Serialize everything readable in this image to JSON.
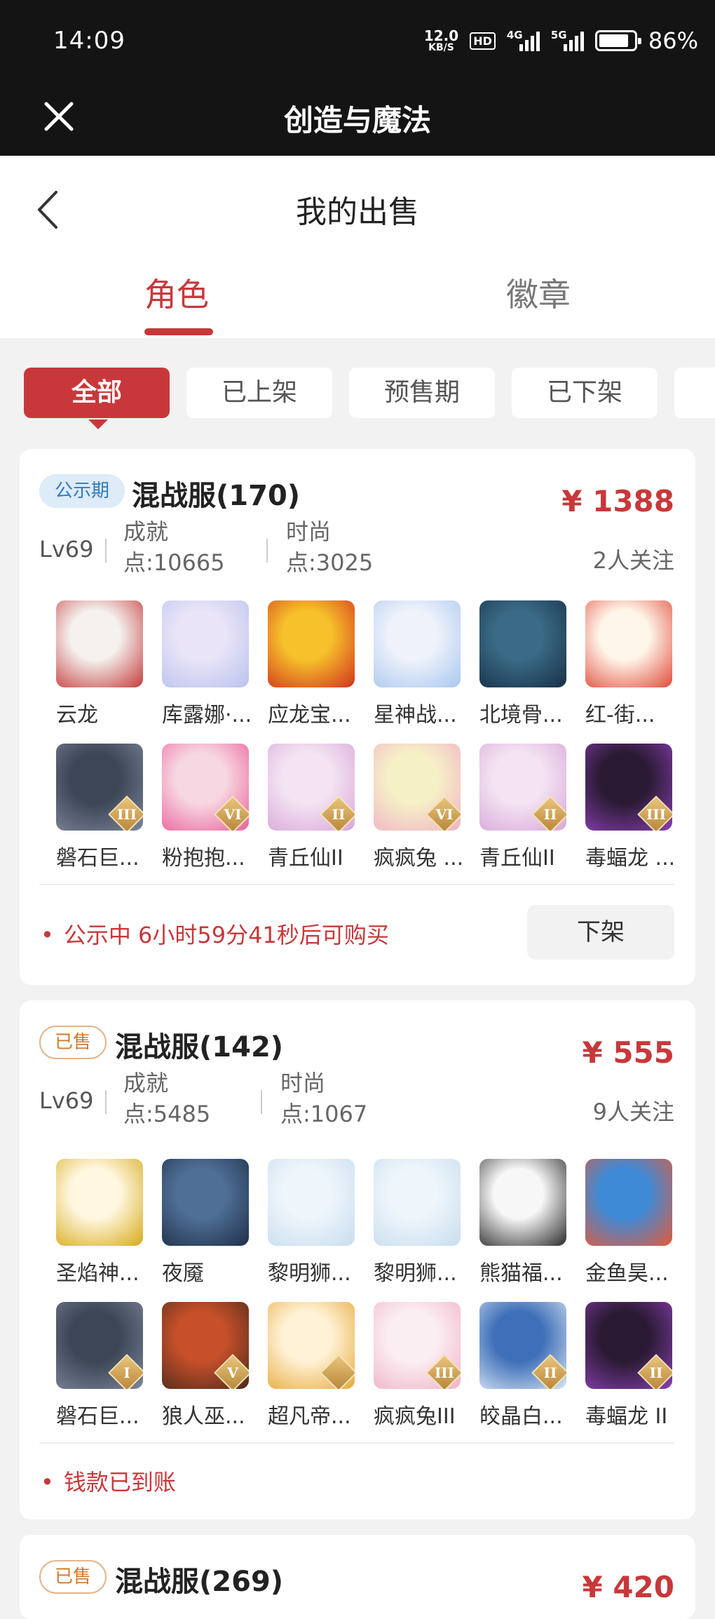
{
  "status": {
    "time": "14:09",
    "speed_value": "12.0",
    "speed_unit": "KB/S",
    "hd": "HD",
    "net1": "4G",
    "net2": "5G",
    "battery": "86%",
    "battery_level": 0.86
  },
  "titlebar": {
    "title": "创造与魔法"
  },
  "header": {
    "title": "我的出售"
  },
  "tabs": [
    {
      "label": "角色"
    },
    {
      "label": "徽章"
    }
  ],
  "filters": [
    "全部",
    "已上架",
    "预售期",
    "已下架",
    "已"
  ],
  "cards": [
    {
      "badge": "公示期",
      "server": "混战服(170)",
      "price": "¥ 1388",
      "level": "Lv69",
      "achievement_label": "成就",
      "achievement_value": "点:10665",
      "fashion_label": "时尚",
      "fashion_value": "点:3025",
      "followers": "2人关注",
      "items": [
        {
          "name": "云龙",
          "icon": "cloud-dragon-icon",
          "colors": [
            "#f4f1ee",
            "#c43b3b"
          ]
        },
        {
          "name": "库露娜·...",
          "icon": "kuluna-icon",
          "colors": [
            "#e9e4f7",
            "#b9c2ef"
          ]
        },
        {
          "name": "应龙宝...",
          "icon": "yinglong-icon",
          "colors": [
            "#f6c12a",
            "#d2321f"
          ]
        },
        {
          "name": "星神战...",
          "icon": "star-god-icon",
          "colors": [
            "#eef2fb",
            "#a9c7ef"
          ]
        },
        {
          "name": "北境骨...",
          "icon": "north-bone-icon",
          "colors": [
            "#3a6a86",
            "#173046"
          ]
        },
        {
          "name": "红-街...",
          "icon": "red-skateboard-icon",
          "colors": [
            "#fff6ea",
            "#e04a3a"
          ]
        },
        {
          "name": "磐石巨...",
          "icon": "rock-giant-icon",
          "colors": [
            "#3d4657",
            "#7d8699"
          ],
          "tier": "III"
        },
        {
          "name": "粉抱抱...",
          "icon": "pink-bear-icon",
          "colors": [
            "#f7d8e2",
            "#ea5f9a"
          ],
          "tier": "VI"
        },
        {
          "name": "青丘仙II",
          "icon": "fox-fairy-icon",
          "colors": [
            "#f4e4f3",
            "#d7a6d8"
          ],
          "tier": "II"
        },
        {
          "name": "疯疯兔 ...",
          "icon": "crazy-rabbit-icon",
          "colors": [
            "#f6f0c7",
            "#f0b2c6"
          ],
          "tier": "VI"
        },
        {
          "name": "青丘仙II",
          "icon": "fox-fairy-icon",
          "colors": [
            "#f4e4f3",
            "#d7a6d8"
          ],
          "tier": "II"
        },
        {
          "name": "毒蝠龙 ...",
          "icon": "poison-bat-dragon-icon",
          "colors": [
            "#2a1a33",
            "#8a3fb2"
          ],
          "tier": "III"
        }
      ],
      "notice": "公示中 6小时59分41秒后可购买",
      "action": "下架"
    },
    {
      "badge": "已售",
      "server": "混战服(142)",
      "price": "¥ 555",
      "level": "Lv69",
      "achievement_label": "成就",
      "achievement_value": "点:5485",
      "fashion_label": "时尚",
      "fashion_value": "点:1067",
      "followers": "9人关注",
      "items": [
        {
          "name": "圣焰神...",
          "icon": "holy-flame-icon",
          "colors": [
            "#fff7e0",
            "#d7a917"
          ]
        },
        {
          "name": "夜魇",
          "icon": "nightmare-icon",
          "colors": [
            "#4f6f96",
            "#1f2f48"
          ]
        },
        {
          "name": "黎明狮...",
          "icon": "dawn-griffin-icon",
          "colors": [
            "#eef5fb",
            "#c7ddef"
          ]
        },
        {
          "name": "黎明狮...",
          "icon": "dawn-griffin-icon",
          "colors": [
            "#eef5fb",
            "#c7ddef"
          ]
        },
        {
          "name": "熊猫福...",
          "icon": "panda-icon",
          "colors": [
            "#f7f7f7",
            "#2a2a2a"
          ]
        },
        {
          "name": "金鱼昊...",
          "icon": "goldfish-icon",
          "colors": [
            "#3f8ad6",
            "#e45a3a"
          ]
        },
        {
          "name": "磐石巨...",
          "icon": "rock-giant-icon",
          "colors": [
            "#3d4657",
            "#7d8699"
          ],
          "tier": "I"
        },
        {
          "name": "狼人巫...",
          "icon": "werewolf-icon",
          "colors": [
            "#c7502a",
            "#4d2a1b"
          ],
          "tier": "V"
        },
        {
          "name": "超凡帝...",
          "icon": "emperor-icon",
          "colors": [
            "#fff2d6",
            "#e6a93a"
          ],
          "tier": ""
        },
        {
          "name": "疯疯兔III",
          "icon": "crazy-rabbit-icon",
          "colors": [
            "#fbeef3",
            "#f0b2c6"
          ],
          "tier": "III"
        },
        {
          "name": "皎晶白...",
          "icon": "crystal-tiger-icon",
          "colors": [
            "#3e6fb8",
            "#d8e5f5"
          ],
          "tier": "II"
        },
        {
          "name": "毒蝠龙 II",
          "icon": "poison-bat-dragon-icon",
          "colors": [
            "#2a1a33",
            "#8a3fb2"
          ],
          "tier": "II"
        }
      ],
      "notice": "钱款已到账"
    },
    {
      "badge": "已售",
      "server": "混战服(269)",
      "price": "¥ 420"
    }
  ],
  "accent": "#c8383a"
}
